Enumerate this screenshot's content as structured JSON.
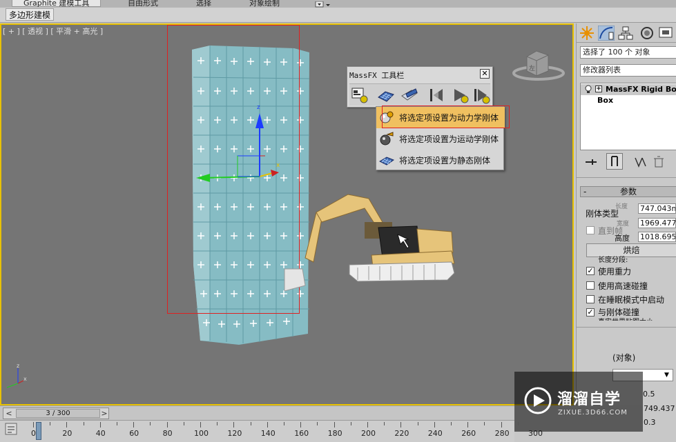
{
  "ribbon": {
    "tabs": [
      "Graphite 建模工具",
      "自由形式",
      "选择",
      "对象绘制"
    ],
    "sub_button": "多边形建模"
  },
  "viewport": {
    "label": "[ + ] [ 透视 ] [ 平滑 + 高光 ]"
  },
  "massfx": {
    "title": "MassFX 工具栏",
    "close": "✕",
    "menu": [
      {
        "label": "将选定项设置为动力学刚体",
        "icon": "dynamic-rigid-body-icon",
        "highlighted": true
      },
      {
        "label": "将选定项设置为运动学刚体",
        "icon": "kinematic-rigid-body-icon",
        "highlighted": false
      },
      {
        "label": "将选定项设置为静态刚体",
        "icon": "static-rigid-body-icon",
        "highlighted": false
      }
    ]
  },
  "command_panel": {
    "selection_info": "选择了 100 个 对象",
    "modifier_list": "修改器列表",
    "stack": [
      {
        "label": "MassFX Rigid Body"
      },
      {
        "label": "Box"
      }
    ],
    "rollout_title": "参数",
    "rigid_body_type_label": "刚体类型",
    "numeric": [
      "747.043m",
      "1969.477(",
      "1018.695("
    ],
    "ghost_labels": {
      "length": "长度",
      "width": "宽度",
      "height": "高度"
    },
    "direct_label": "直到帧",
    "bake_button": "烘焙",
    "partial_label": "长度分段:",
    "checkboxes": [
      {
        "label": "使用重力",
        "checked": true
      },
      {
        "label": "使用高速碰撞",
        "checked": false
      },
      {
        "label": "在睡眠模式中启动",
        "checked": false
      },
      {
        "label": "与刚体碰撞",
        "checked": true
      }
    ],
    "partial_checkbox_label": "真实世界贴图大小",
    "object_label": "(对象)",
    "bottom_values": [
      "0.5",
      "749.437",
      "0.3"
    ]
  },
  "watermark": {
    "title": "溜溜自学",
    "url": "ZIXUE.3D66.COM"
  },
  "timeline": {
    "frame_display": "3 / 300",
    "prev": "<",
    "next": ">",
    "ticks": [
      "0",
      "20",
      "40",
      "60",
      "80",
      "100",
      "120",
      "140",
      "160",
      "180",
      "200",
      "220",
      "240",
      "260",
      "280",
      "300"
    ]
  },
  "colors": {
    "viewport_bg": "#757575",
    "viewport_border": "#e8c100",
    "wall": "#86bcc4",
    "excavator": "#e6c47a",
    "highlight": "#f0c060"
  }
}
